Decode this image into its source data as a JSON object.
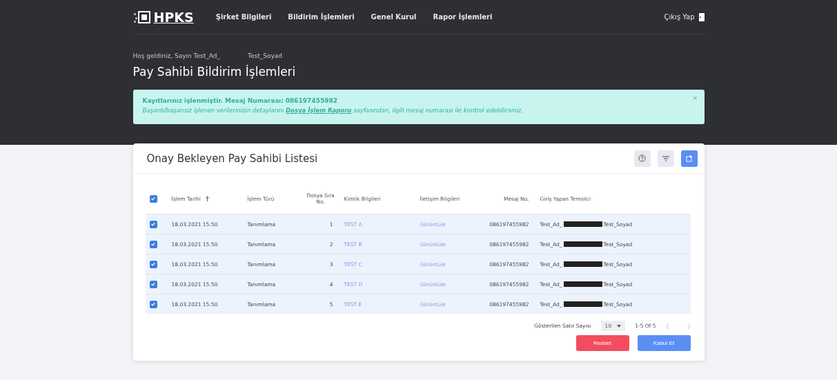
{
  "nav": {
    "logo": "HPKS",
    "items": [
      "Şirket Bilgileri",
      "Bildirim İşlemleri",
      "Genel Kurul",
      "Rapor İşlemleri"
    ],
    "logout": "Çıkış Yap"
  },
  "welcome": {
    "greeting": "Hoş geldiniz, Sayın Test_Ad_",
    "surname": "Test_Soyad"
  },
  "page_title": "Pay Sahibi Bildirim İşlemleri",
  "alert": {
    "title": "Kayıtlarınız işlenmiştir. Mesaj Numarası: 086197455982",
    "before": "Başarılı/başarısız işlenen verilerinizin detaylarını",
    "link": "Dosya İşlem Raporu",
    "after": "sayfasından, ilgili mesaj numarası ile kontrol edebilirsiniz.",
    "close": "×"
  },
  "card": {
    "title": "Onay Bekleyen Pay Sahibi Listesi",
    "all_checked": true,
    "columns": [
      "İşlem Tarihi",
      "İşlem Türü",
      "Dosya Sıra No.",
      "Kimlik Bilgileri",
      "İletişim Bilgileri",
      "Mesaj No.",
      "Giriş Yapan Temsilci"
    ],
    "rows": [
      {
        "checked": true,
        "date": "18.03.2021 15:50",
        "type": "Tanımlama",
        "no": "1",
        "identity": "TEST A",
        "contact": "Görüntüle",
        "message": "086197455982",
        "rep_first": "Test_Ad_",
        "rep_last": "Test_Soyad"
      },
      {
        "checked": true,
        "date": "18.03.2021 15:50",
        "type": "Tanımlama",
        "no": "2",
        "identity": "TEST B",
        "contact": "Görüntüle",
        "message": "086197455982",
        "rep_first": "Test_Ad_",
        "rep_last": "Test_Soyad"
      },
      {
        "checked": true,
        "date": "18.03.2021 15:50",
        "type": "Tanımlama",
        "no": "3",
        "identity": "TEST C",
        "contact": "Görüntüle",
        "message": "086197455982",
        "rep_first": "Test_Ad_",
        "rep_last": "Test_Soyad"
      },
      {
        "checked": true,
        "date": "18.03.2021 15:50",
        "type": "Tanımlama",
        "no": "4",
        "identity": "TEST D",
        "contact": "Görüntüle",
        "message": "086197455982",
        "rep_first": "Test_Ad_",
        "rep_last": "Test_Soyad"
      },
      {
        "checked": true,
        "date": "18.03.2021 15:50",
        "type": "Tanımlama",
        "no": "5",
        "identity": "TEST E",
        "contact": "Görüntüle",
        "message": "086197455982",
        "rep_first": "Test_Ad_",
        "rep_last": "Test_Soyad"
      }
    ],
    "pagination": {
      "label": "Gösterilen Satır Sayısı",
      "page_size": "10",
      "range": "1-5 Of 5"
    },
    "buttons": [
      {
        "kind": "reject",
        "label": "Reddet"
      },
      {
        "kind": "accept",
        "label": "Kabul Et"
      }
    ]
  }
}
